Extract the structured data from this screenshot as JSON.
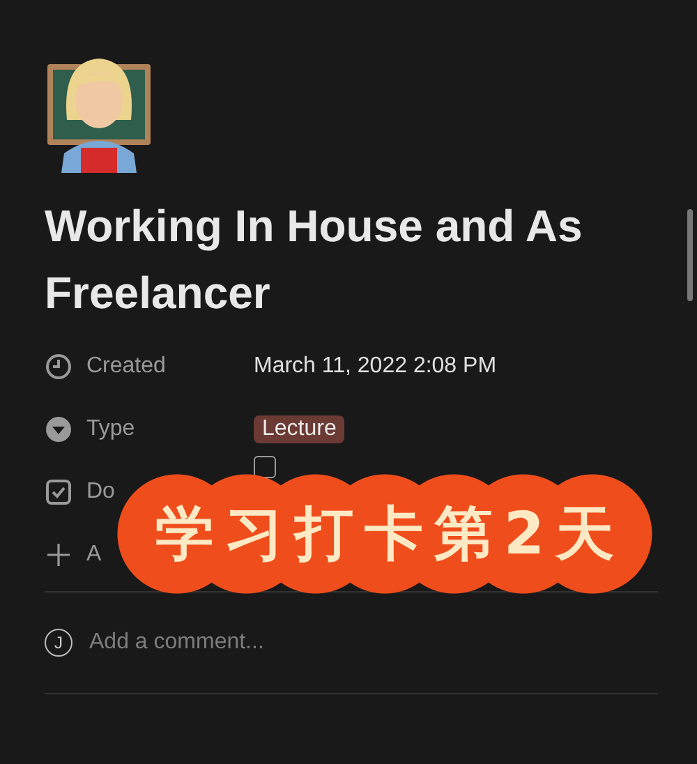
{
  "page": {
    "title": "Working In House and As Freelancer"
  },
  "properties": [
    {
      "kind": "created",
      "label": "Created",
      "value": "March 11, 2022 2:08 PM"
    },
    {
      "kind": "select",
      "label": "Type",
      "value": "Lecture",
      "color": "#6b3a34"
    },
    {
      "kind": "checkbox",
      "label": "Do",
      "checked": false
    },
    {
      "kind": "add",
      "label": "A"
    }
  ],
  "comment": {
    "avatar": "J",
    "placeholder": "Add a comment..."
  },
  "sticker": {
    "text": "学习打卡第2天"
  }
}
